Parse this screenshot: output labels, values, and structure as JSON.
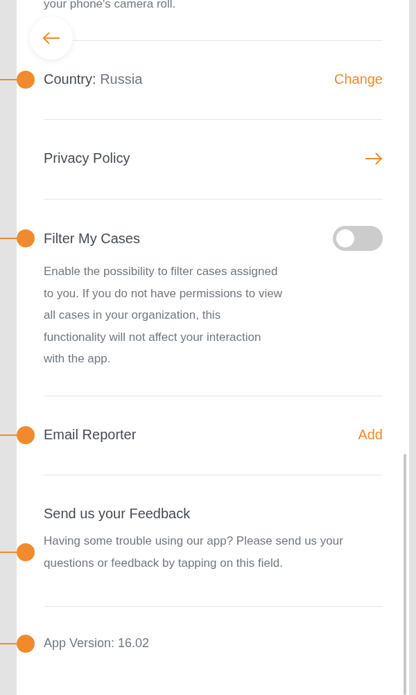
{
  "top_text": "your phone's camera roll.",
  "items": [
    {
      "kind": "value_action",
      "label": "Country:",
      "value": "Russia",
      "action": "Change",
      "marker": true
    },
    {
      "kind": "link",
      "label": "Privacy Policy",
      "marker": false
    },
    {
      "kind": "toggle",
      "label": "Filter My Cases",
      "on": false,
      "description": "Enable the possibility to filter cases assigned to you. If you do not have permissions to view all cases in your organization, this functionality will not affect your interaction with the app.",
      "marker": true
    },
    {
      "kind": "action",
      "label": "Email Reporter",
      "action": "Add",
      "marker": true
    },
    {
      "kind": "info",
      "label": "Send us your Feedback",
      "description": "Having some trouble using our app? Please send us your questions or feedback by tapping on this field.",
      "marker": true
    },
    {
      "kind": "version",
      "label": "App Version: 16.02",
      "marker": true
    }
  ]
}
